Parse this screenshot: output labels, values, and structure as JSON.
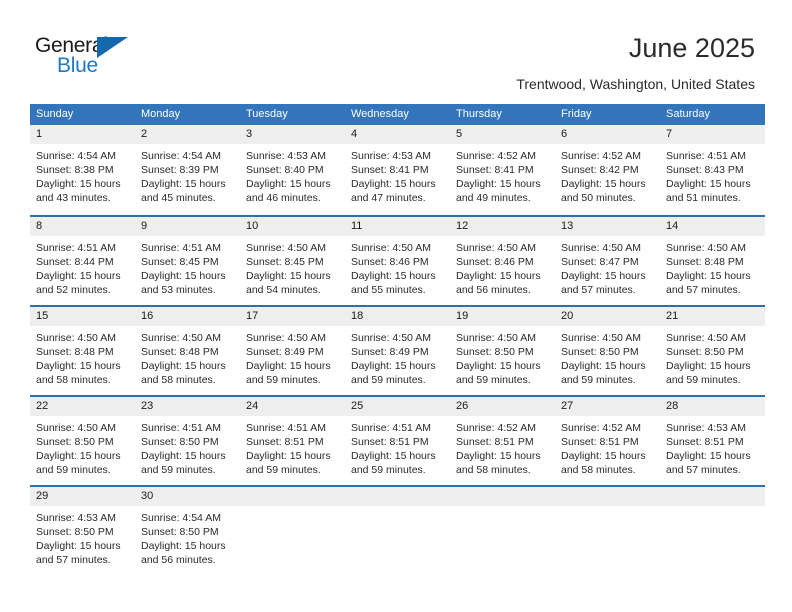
{
  "brand": {
    "name_part1": "General",
    "name_part2": "Blue",
    "flag_icon": "triangle-flag-icon"
  },
  "header": {
    "title": "June 2025",
    "location": "Trentwood, Washington, United States"
  },
  "colors": {
    "header_blue": "#3275ba",
    "row_divider_blue": "#2d6fb3",
    "day_band_gray": "#eeeeee",
    "brand_blue": "#1f7ac4",
    "text": "#2b2b2b"
  },
  "calendar": {
    "weekdays": [
      "Sunday",
      "Monday",
      "Tuesday",
      "Wednesday",
      "Thursday",
      "Friday",
      "Saturday"
    ],
    "weeks": [
      [
        {
          "day": "1",
          "sunrise": "Sunrise: 4:54 AM",
          "sunset": "Sunset: 8:38 PM",
          "daylight": "Daylight: 15 hours and 43 minutes."
        },
        {
          "day": "2",
          "sunrise": "Sunrise: 4:54 AM",
          "sunset": "Sunset: 8:39 PM",
          "daylight": "Daylight: 15 hours and 45 minutes."
        },
        {
          "day": "3",
          "sunrise": "Sunrise: 4:53 AM",
          "sunset": "Sunset: 8:40 PM",
          "daylight": "Daylight: 15 hours and 46 minutes."
        },
        {
          "day": "4",
          "sunrise": "Sunrise: 4:53 AM",
          "sunset": "Sunset: 8:41 PM",
          "daylight": "Daylight: 15 hours and 47 minutes."
        },
        {
          "day": "5",
          "sunrise": "Sunrise: 4:52 AM",
          "sunset": "Sunset: 8:41 PM",
          "daylight": "Daylight: 15 hours and 49 minutes."
        },
        {
          "day": "6",
          "sunrise": "Sunrise: 4:52 AM",
          "sunset": "Sunset: 8:42 PM",
          "daylight": "Daylight: 15 hours and 50 minutes."
        },
        {
          "day": "7",
          "sunrise": "Sunrise: 4:51 AM",
          "sunset": "Sunset: 8:43 PM",
          "daylight": "Daylight: 15 hours and 51 minutes."
        }
      ],
      [
        {
          "day": "8",
          "sunrise": "Sunrise: 4:51 AM",
          "sunset": "Sunset: 8:44 PM",
          "daylight": "Daylight: 15 hours and 52 minutes."
        },
        {
          "day": "9",
          "sunrise": "Sunrise: 4:51 AM",
          "sunset": "Sunset: 8:45 PM",
          "daylight": "Daylight: 15 hours and 53 minutes."
        },
        {
          "day": "10",
          "sunrise": "Sunrise: 4:50 AM",
          "sunset": "Sunset: 8:45 PM",
          "daylight": "Daylight: 15 hours and 54 minutes."
        },
        {
          "day": "11",
          "sunrise": "Sunrise: 4:50 AM",
          "sunset": "Sunset: 8:46 PM",
          "daylight": "Daylight: 15 hours and 55 minutes."
        },
        {
          "day": "12",
          "sunrise": "Sunrise: 4:50 AM",
          "sunset": "Sunset: 8:46 PM",
          "daylight": "Daylight: 15 hours and 56 minutes."
        },
        {
          "day": "13",
          "sunrise": "Sunrise: 4:50 AM",
          "sunset": "Sunset: 8:47 PM",
          "daylight": "Daylight: 15 hours and 57 minutes."
        },
        {
          "day": "14",
          "sunrise": "Sunrise: 4:50 AM",
          "sunset": "Sunset: 8:48 PM",
          "daylight": "Daylight: 15 hours and 57 minutes."
        }
      ],
      [
        {
          "day": "15",
          "sunrise": "Sunrise: 4:50 AM",
          "sunset": "Sunset: 8:48 PM",
          "daylight": "Daylight: 15 hours and 58 minutes."
        },
        {
          "day": "16",
          "sunrise": "Sunrise: 4:50 AM",
          "sunset": "Sunset: 8:48 PM",
          "daylight": "Daylight: 15 hours and 58 minutes."
        },
        {
          "day": "17",
          "sunrise": "Sunrise: 4:50 AM",
          "sunset": "Sunset: 8:49 PM",
          "daylight": "Daylight: 15 hours and 59 minutes."
        },
        {
          "day": "18",
          "sunrise": "Sunrise: 4:50 AM",
          "sunset": "Sunset: 8:49 PM",
          "daylight": "Daylight: 15 hours and 59 minutes."
        },
        {
          "day": "19",
          "sunrise": "Sunrise: 4:50 AM",
          "sunset": "Sunset: 8:50 PM",
          "daylight": "Daylight: 15 hours and 59 minutes."
        },
        {
          "day": "20",
          "sunrise": "Sunrise: 4:50 AM",
          "sunset": "Sunset: 8:50 PM",
          "daylight": "Daylight: 15 hours and 59 minutes."
        },
        {
          "day": "21",
          "sunrise": "Sunrise: 4:50 AM",
          "sunset": "Sunset: 8:50 PM",
          "daylight": "Daylight: 15 hours and 59 minutes."
        }
      ],
      [
        {
          "day": "22",
          "sunrise": "Sunrise: 4:50 AM",
          "sunset": "Sunset: 8:50 PM",
          "daylight": "Daylight: 15 hours and 59 minutes."
        },
        {
          "day": "23",
          "sunrise": "Sunrise: 4:51 AM",
          "sunset": "Sunset: 8:50 PM",
          "daylight": "Daylight: 15 hours and 59 minutes."
        },
        {
          "day": "24",
          "sunrise": "Sunrise: 4:51 AM",
          "sunset": "Sunset: 8:51 PM",
          "daylight": "Daylight: 15 hours and 59 minutes."
        },
        {
          "day": "25",
          "sunrise": "Sunrise: 4:51 AM",
          "sunset": "Sunset: 8:51 PM",
          "daylight": "Daylight: 15 hours and 59 minutes."
        },
        {
          "day": "26",
          "sunrise": "Sunrise: 4:52 AM",
          "sunset": "Sunset: 8:51 PM",
          "daylight": "Daylight: 15 hours and 58 minutes."
        },
        {
          "day": "27",
          "sunrise": "Sunrise: 4:52 AM",
          "sunset": "Sunset: 8:51 PM",
          "daylight": "Daylight: 15 hours and 58 minutes."
        },
        {
          "day": "28",
          "sunrise": "Sunrise: 4:53 AM",
          "sunset": "Sunset: 8:51 PM",
          "daylight": "Daylight: 15 hours and 57 minutes."
        }
      ],
      [
        {
          "day": "29",
          "sunrise": "Sunrise: 4:53 AM",
          "sunset": "Sunset: 8:50 PM",
          "daylight": "Daylight: 15 hours and 57 minutes."
        },
        {
          "day": "30",
          "sunrise": "Sunrise: 4:54 AM",
          "sunset": "Sunset: 8:50 PM",
          "daylight": "Daylight: 15 hours and 56 minutes."
        },
        {
          "day": "",
          "sunrise": "",
          "sunset": "",
          "daylight": ""
        },
        {
          "day": "",
          "sunrise": "",
          "sunset": "",
          "daylight": ""
        },
        {
          "day": "",
          "sunrise": "",
          "sunset": "",
          "daylight": ""
        },
        {
          "day": "",
          "sunrise": "",
          "sunset": "",
          "daylight": ""
        },
        {
          "day": "",
          "sunrise": "",
          "sunset": "",
          "daylight": ""
        }
      ]
    ]
  }
}
